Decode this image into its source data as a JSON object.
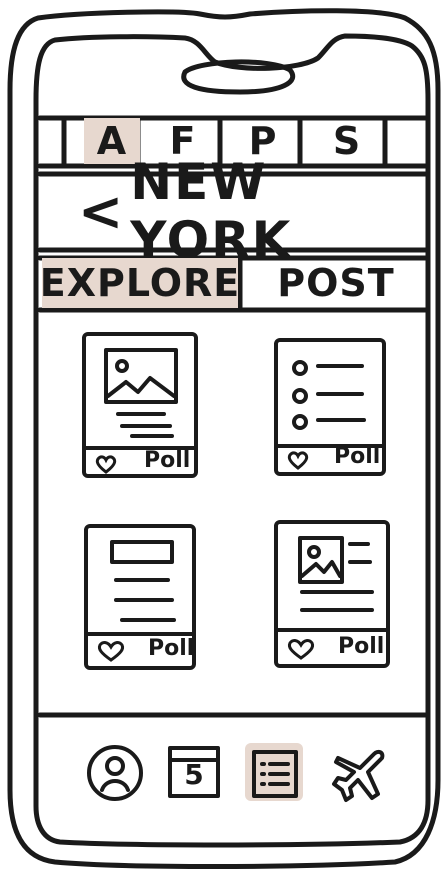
{
  "tabs": [
    "A",
    "F",
    "P",
    "S"
  ],
  "header": {
    "back_symbol": "<",
    "city": "NEW YORK"
  },
  "segments": {
    "explore": "EXPLORE",
    "post": "POST"
  },
  "cards": [
    {
      "type": "image-card",
      "icon": "heart-icon",
      "action": "Poll"
    },
    {
      "type": "list-card",
      "icon": "heart-icon",
      "action": "Poll"
    },
    {
      "type": "text-card",
      "icon": "heart-icon",
      "action": "Poll"
    },
    {
      "type": "media-text-card",
      "icon": "heart-icon",
      "action": "Poll"
    }
  ],
  "bottom_nav": {
    "items": [
      {
        "name": "profile",
        "icon": "profile-icon"
      },
      {
        "name": "calendar",
        "icon": "calendar-icon",
        "label": "5"
      },
      {
        "name": "list",
        "icon": "list-icon"
      },
      {
        "name": "flights",
        "icon": "airplane-icon"
      }
    ]
  },
  "colors": {
    "accent": "#e7d8cf",
    "ink": "#1a1a1a"
  }
}
